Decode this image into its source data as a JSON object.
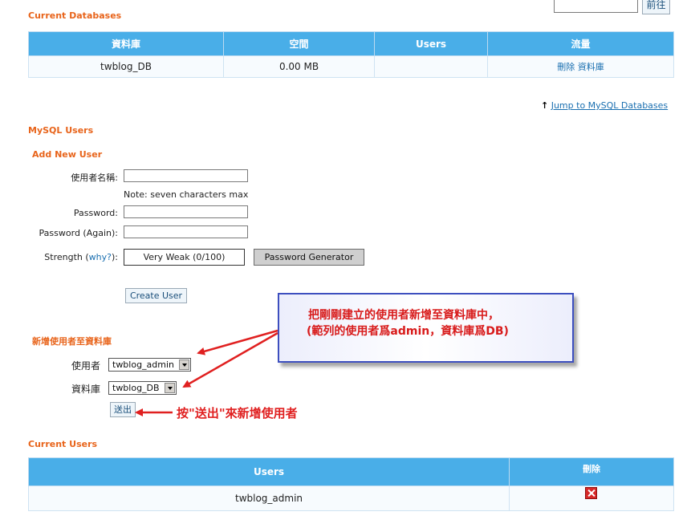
{
  "top": {
    "go_button": "前往"
  },
  "current_databases": {
    "title": "Current Databases",
    "headers": [
      "資料庫",
      "空間",
      "Users",
      "流量"
    ],
    "rows": [
      {
        "db": "twblog_DB",
        "size": "0.00 MB",
        "users": "",
        "actions": "刪除 資料庫"
      }
    ]
  },
  "jump_link": "Jump to MySQL Databases",
  "mysql_users": {
    "title": "MySQL Users",
    "add_new_user": "Add New User",
    "username_label": "使用者名稱:",
    "username_note": "Note: seven characters max",
    "password_label": "Password:",
    "password_again_label": "Password (Again):",
    "strength_label": "Strength (",
    "strength_why": "why?",
    "strength_suffix": "):",
    "strength_value": "Very Weak (0/100)",
    "password_generator": "Password Generator",
    "create_user": "Create User"
  },
  "add_user_to_db": {
    "title": "新增使用者至資料庫",
    "user_label": "使用者",
    "user_selected": "twblog_admin",
    "db_label": "資料庫",
    "db_selected": "twblog_DB",
    "submit": "送出"
  },
  "annotations": {
    "callout_line1": "把剛剛建立的使用者新增至資料庫中，",
    "callout_line2": "(範列的使用者爲admin，資料庫爲DB)",
    "submit_hint": "按\"送出\"來新增使用者"
  },
  "current_users": {
    "title": "Current Users",
    "headers": [
      "Users",
      "刪除"
    ],
    "rows": [
      {
        "user": "twblog_admin"
      }
    ]
  },
  "colors": {
    "header_blue": "#49aee8",
    "section_orange": "#e8641b",
    "annotation_red": "#e02020",
    "callout_border": "#3d4fbf"
  }
}
